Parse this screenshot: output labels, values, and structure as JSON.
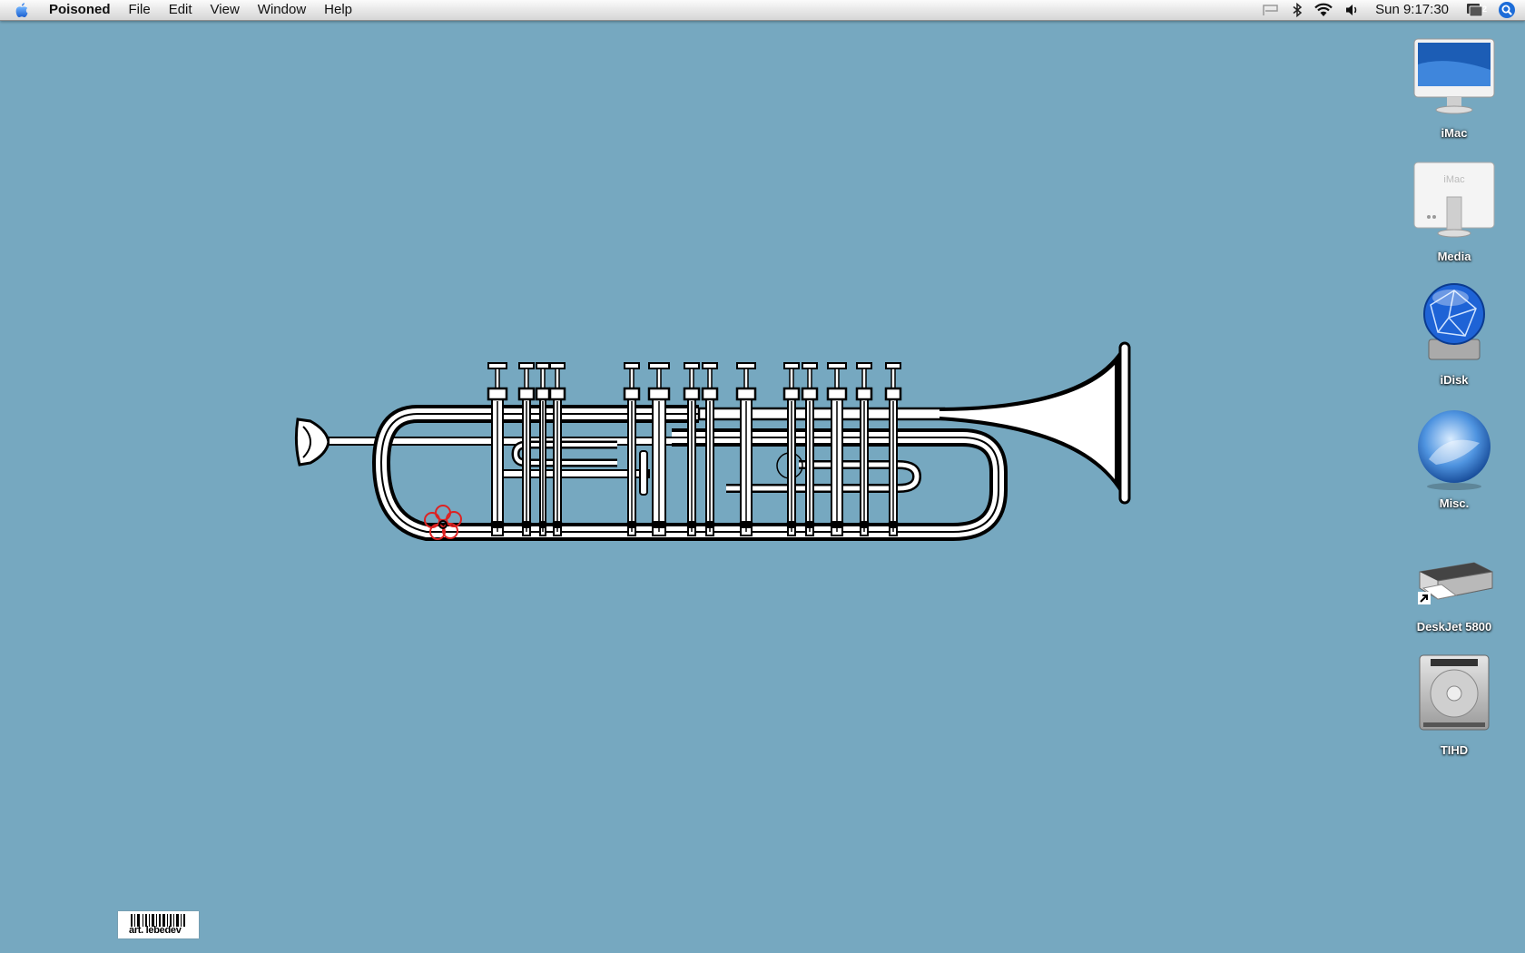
{
  "menubar": {
    "apple_icon": "apple-icon",
    "app_name": "Poisoned",
    "menus": [
      "File",
      "Edit",
      "View",
      "Window",
      "Help"
    ],
    "status_icons": [
      "flag-icon",
      "bluetooth-icon",
      "wifi-icon",
      "volume-icon"
    ],
    "clock": "Sun 9:17:30",
    "extras": [
      "spaces-icon",
      "spotlight-icon"
    ],
    "spaces_number": "2"
  },
  "desktop": {
    "background_color": "#76a8c0",
    "icons": [
      {
        "label": "iMac",
        "icon": "imac-front-icon"
      },
      {
        "label": "Media",
        "icon": "imac-back-icon"
      },
      {
        "label": "iDisk",
        "icon": "idisk-icon"
      },
      {
        "label": "Misc.",
        "icon": "blue-orb-icon"
      },
      {
        "label": "DeskJet 5800",
        "icon": "printer-icon"
      },
      {
        "label": "TIHD",
        "icon": "hard-drive-icon"
      }
    ]
  },
  "wallpaper": {
    "subject": "trumpet-illustration",
    "logo_text": "art. lebedev"
  }
}
